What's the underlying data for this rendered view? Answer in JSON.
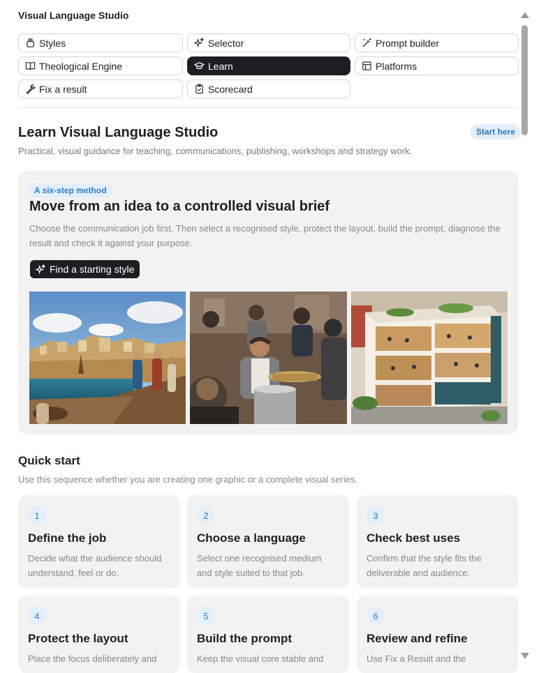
{
  "app": {
    "title": "Visual Language Studio"
  },
  "nav": {
    "items": [
      {
        "label": "Styles",
        "icon": "layers-icon",
        "active": false
      },
      {
        "label": "Selector",
        "icon": "sparkles-icon",
        "active": false
      },
      {
        "label": "Prompt builder",
        "icon": "magic-wand-icon",
        "active": false
      },
      {
        "label": "Theological Engine",
        "icon": "book-open-icon",
        "active": false
      },
      {
        "label": "Learn",
        "icon": "graduation-cap-icon",
        "active": true
      },
      {
        "label": "Platforms",
        "icon": "layout-icon",
        "active": false
      },
      {
        "label": "Fix a result",
        "icon": "wrench-icon",
        "active": false
      },
      {
        "label": "Scorecard",
        "icon": "clipboard-check-icon",
        "active": false
      }
    ]
  },
  "learn": {
    "title": "Learn Visual Language Studio",
    "subtitle": "Practical, visual guidance for teaching, communications, publishing, workshops and strategy work.",
    "badge": "Start here"
  },
  "hero": {
    "badge": "A six-step method",
    "title": "Move from an idea to a controlled visual brief",
    "description": "Choose the communication job first. Then select a recognised style, protect the layout, build the prompt, diagnose the result and check it against your purpose.",
    "cta": "Find a starting style",
    "images": [
      "ancient-harbour-scene",
      "community-kitchen-photo",
      "cutaway-building-illustration"
    ]
  },
  "quickstart": {
    "title": "Quick start",
    "subtitle": "Use this sequence whether you are creating one graphic or a complete visual series.",
    "steps": [
      {
        "num": "1",
        "title": "Define the job",
        "desc": "Decide what the audience should understand, feel or do."
      },
      {
        "num": "2",
        "title": "Choose a language",
        "desc": "Select one recognised medium and style suited to that job."
      },
      {
        "num": "3",
        "title": "Check best uses",
        "desc": "Confirm that the style fits the deliverable and audience."
      },
      {
        "num": "4",
        "title": "Protect the layout",
        "desc": "Place the focus deliberately and"
      },
      {
        "num": "5",
        "title": "Build the prompt",
        "desc": "Keep the visual core stable and"
      },
      {
        "num": "6",
        "title": "Review and refine",
        "desc": "Use Fix a Result and the"
      }
    ]
  },
  "colors": {
    "accent": "#2f7fc8",
    "dark": "#1e1e21",
    "card": "#f2f2f2"
  }
}
